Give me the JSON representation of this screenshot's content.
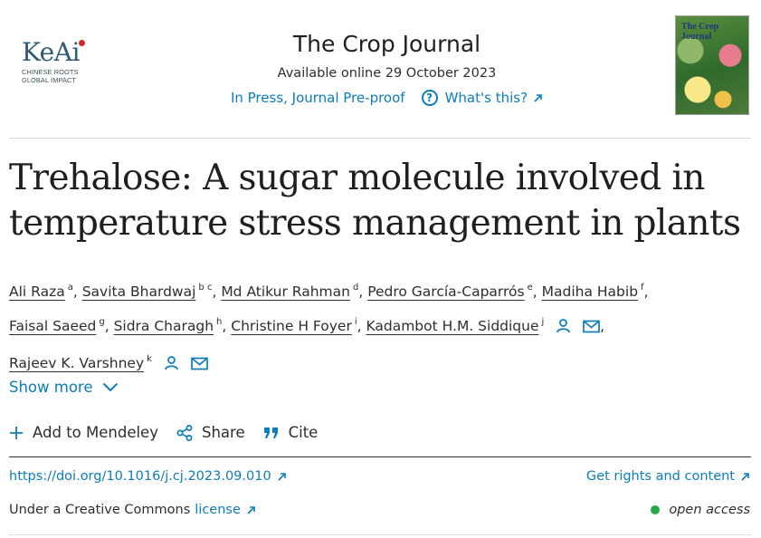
{
  "logo": {
    "wordmark": "KeAi",
    "tagline_1": "CHINESE ROOTS",
    "tagline_2": "GLOBAL IMPACT"
  },
  "journal": {
    "title": "The Crop Journal",
    "availability": "Available online 29 October 2023",
    "status": "In Press, Journal Pre-proof",
    "whats_this": "What's this?",
    "cover_label": "The Crop Journal"
  },
  "article": {
    "title": "Trehalose: A sugar molecule involved in temperature stress management in plants"
  },
  "authors": [
    {
      "name": "Ali Raza",
      "aff": "a"
    },
    {
      "name": "Savita Bhardwaj",
      "aff": "b c"
    },
    {
      "name": "Md Atikur Rahman",
      "aff": "d"
    },
    {
      "name": "Pedro García-Caparrós",
      "aff": "e"
    },
    {
      "name": "Madiha Habib",
      "aff": "f"
    },
    {
      "name": "Faisal Saeed",
      "aff": "g"
    },
    {
      "name": "Sidra Charagh",
      "aff": "h"
    },
    {
      "name": "Christine H Foyer",
      "aff": "i"
    },
    {
      "name": "Kadambot H.M. Siddique",
      "aff": "j"
    },
    {
      "name": "Rajeev K. Varshney",
      "aff": "k"
    }
  ],
  "show_more": "Show more",
  "actions": {
    "mendeley": "Add to Mendeley",
    "share": "Share",
    "cite": "Cite"
  },
  "doi": "https://doi.org/10.1016/j.cj.2023.09.010",
  "rights": "Get rights and content",
  "license": {
    "prefix": "Under a Creative Commons",
    "link": "license"
  },
  "access": "open access",
  "colors": {
    "link": "#0c7dbb",
    "text": "#2e2e2e",
    "open_access_dot": "#27a844",
    "keai_red": "#d6262c"
  }
}
